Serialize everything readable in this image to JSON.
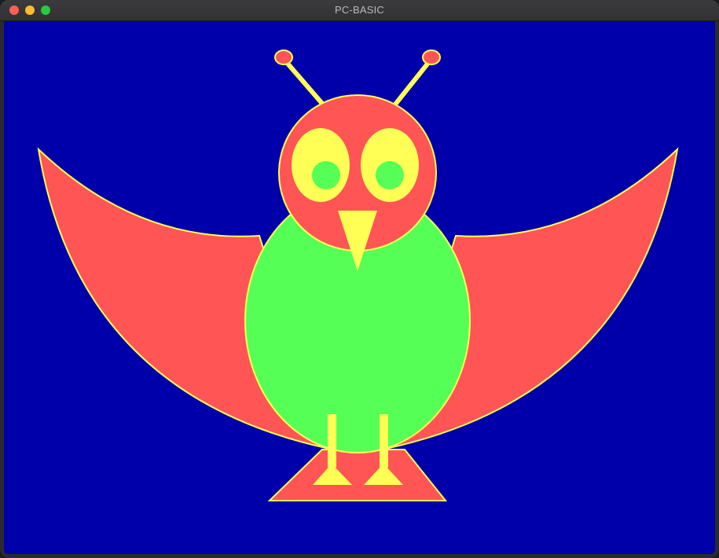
{
  "window": {
    "title": "PC-BASIC"
  },
  "colors": {
    "background": "#0000aa",
    "red": "#ff5555",
    "yellow": "#ffff55",
    "green": "#55ff55"
  },
  "icons": [
    "close-traffic-light",
    "minimize-traffic-light",
    "zoom-traffic-light"
  ]
}
